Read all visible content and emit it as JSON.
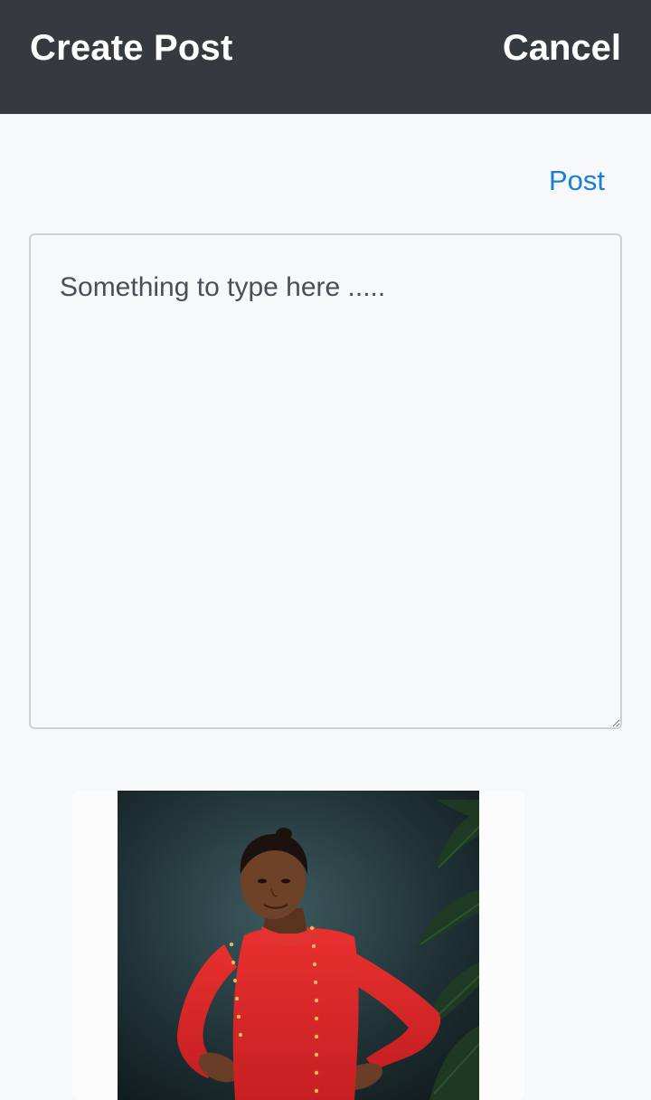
{
  "header": {
    "title": "Create Post",
    "cancel_label": "Cancel",
    "background": "#353940"
  },
  "actions": {
    "post_label": "Post",
    "accent_color": "#1a7fd4"
  },
  "composer": {
    "placeholder": "Something to type here .....",
    "value": ""
  },
  "attachment": {
    "kind": "photo",
    "subject": "person-portrait"
  }
}
